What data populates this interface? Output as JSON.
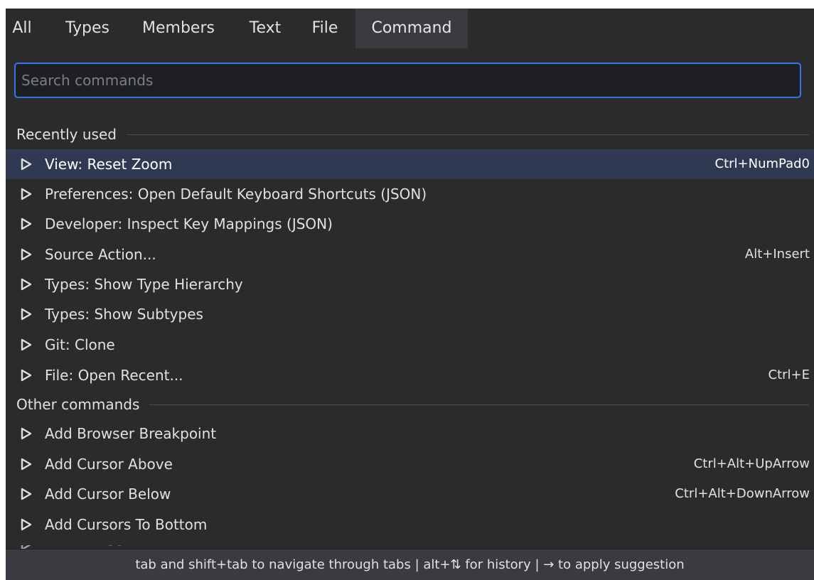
{
  "tabs": [
    {
      "label": "All",
      "active": false
    },
    {
      "label": "Types",
      "active": false
    },
    {
      "label": "Members",
      "active": false
    },
    {
      "label": "Text",
      "active": false
    },
    {
      "label": "File",
      "active": false
    },
    {
      "label": "Command",
      "active": true
    }
  ],
  "search": {
    "placeholder": "Search commands",
    "value": ""
  },
  "sections": [
    {
      "label": "Recently used"
    },
    {
      "label": "Other commands"
    }
  ],
  "recent": [
    {
      "label": "View: Reset Zoom",
      "shortcut": "Ctrl+NumPad0",
      "selected": true
    },
    {
      "label": "Preferences: Open Default Keyboard Shortcuts (JSON)",
      "shortcut": ""
    },
    {
      "label": "Developer: Inspect Key Mappings (JSON)",
      "shortcut": ""
    },
    {
      "label": "Source Action...",
      "shortcut": "Alt+Insert"
    },
    {
      "label": "Types: Show Type Hierarchy",
      "shortcut": ""
    },
    {
      "label": "Types: Show Subtypes",
      "shortcut": ""
    },
    {
      "label": "Git: Clone",
      "shortcut": ""
    },
    {
      "label": "File: Open Recent...",
      "shortcut": "Ctrl+E"
    }
  ],
  "other": [
    {
      "label": "Add Browser Breakpoint",
      "shortcut": ""
    },
    {
      "label": "Add Cursor Above",
      "shortcut": "Ctrl+Alt+UpArrow"
    },
    {
      "label": "Add Cursor Below",
      "shortcut": "Ctrl+Alt+DownArrow"
    },
    {
      "label": "Add Cursors To Bottom",
      "shortcut": ""
    }
  ],
  "partial_row": {
    "label": "Build Frogger: Build Freebox Adios"
  },
  "footer": {
    "hint": "tab and shift+tab to navigate through tabs | alt+⇅ for history | → to apply suggestion"
  },
  "icons": {
    "row": "run-triangle-icon"
  },
  "colors": {
    "background": "#2b2b2b",
    "active_tab": "#393b40",
    "focus_border": "#3574f0",
    "selection": "#2f3a52",
    "text": "#dfe1e5"
  }
}
